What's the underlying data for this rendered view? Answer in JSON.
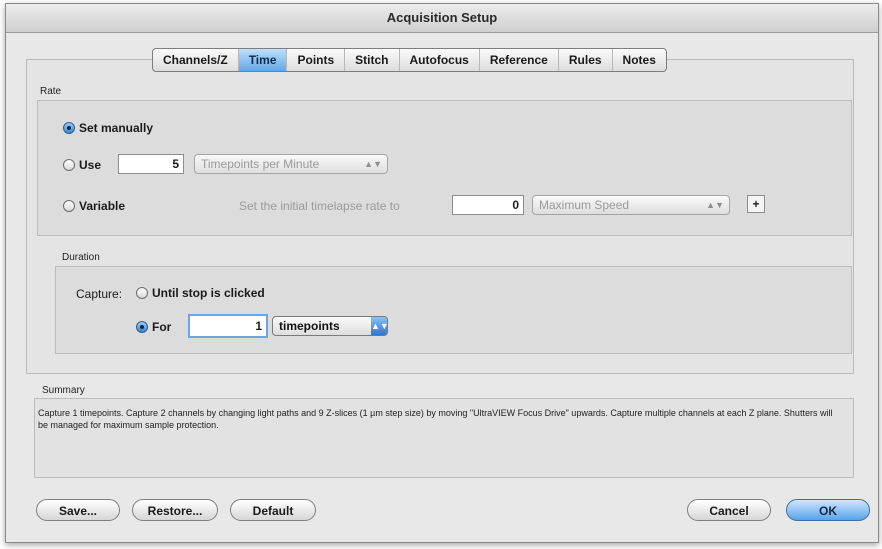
{
  "window": {
    "title": "Acquisition Setup"
  },
  "tabs": [
    {
      "label": "Channels/Z",
      "active": false
    },
    {
      "label": "Time",
      "active": true
    },
    {
      "label": "Points",
      "active": false
    },
    {
      "label": "Stitch",
      "active": false
    },
    {
      "label": "Autofocus",
      "active": false
    },
    {
      "label": "Reference",
      "active": false
    },
    {
      "label": "Rules",
      "active": false
    },
    {
      "label": "Notes",
      "active": false
    }
  ],
  "rate": {
    "section_label": "Rate",
    "set_manually_label": "Set manually",
    "use_label": "Use",
    "use_value": "5",
    "use_unit": "Timepoints per Minute",
    "variable_label": "Variable",
    "initial_rate_label": "Set the initial timelapse rate to",
    "initial_rate_value": "0",
    "speed_option": "Maximum Speed",
    "plus_label": "+",
    "selected": "set_manually"
  },
  "duration": {
    "section_label": "Duration",
    "capture_label": "Capture:",
    "until_stop_label": "Until stop is clicked",
    "for_label": "For",
    "for_value": "1",
    "unit": "timepoints",
    "selected": "for"
  },
  "summary": {
    "section_label": "Summary",
    "text": "Capture 1 timepoints.  Capture 2 channels by changing light paths and 9 Z-slices (1 µm step size) by moving \"UltraVIEW Focus Drive\" upwards.  Capture multiple channels at each Z plane.  Shutters will be managed for maximum sample protection."
  },
  "buttons": {
    "save": "Save...",
    "restore": "Restore...",
    "default": "Default",
    "cancel": "Cancel",
    "ok": "OK"
  },
  "colors": {
    "accent": "#5aa3ea",
    "window_bg": "#e8e8e8"
  }
}
